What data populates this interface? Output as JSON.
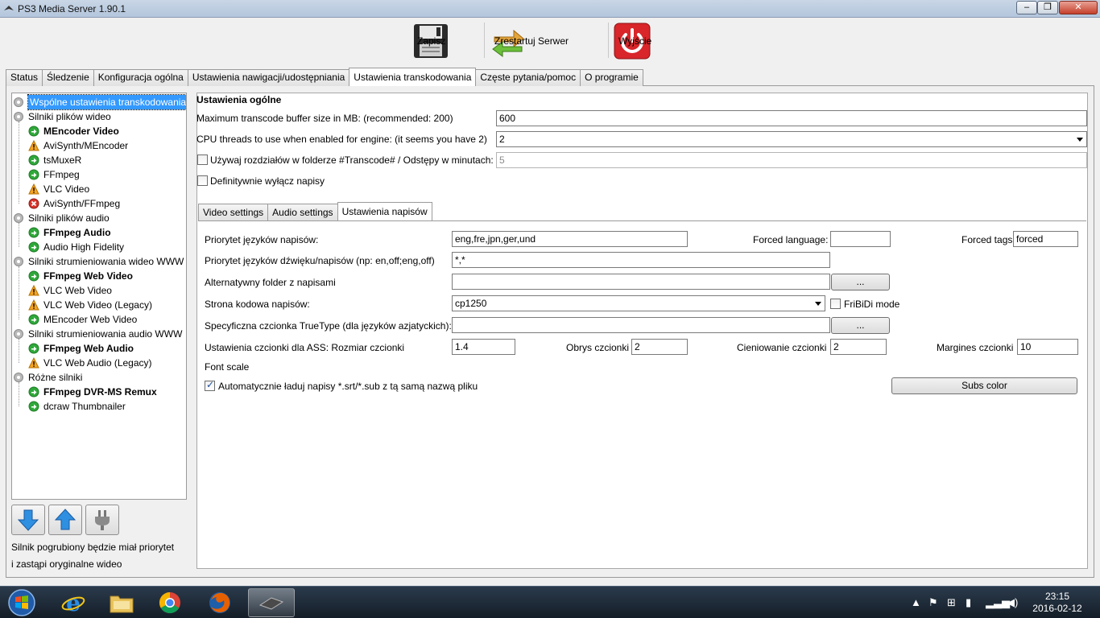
{
  "window": {
    "title": "PS3 Media Server 1.90.1",
    "minimize": "–",
    "maximize": "❐",
    "close": "✕"
  },
  "toolbar": {
    "save": "Zapisz",
    "restart": "Zrestartuj Serwer",
    "exit": "Wyjście"
  },
  "main_tabs": [
    "Status",
    "Śledzenie",
    "Konfiguracja ogólna",
    "Ustawienia nawigacji/udostępniania",
    "Ustawienia transkodowania",
    "Częste pytania/pomoc",
    "O programie"
  ],
  "tree": [
    {
      "label": "Wspólne ustawienia transkodowania",
      "level": 0,
      "icon": "gear-icon",
      "bold": false,
      "selected": true
    },
    {
      "label": "Silniki plików wideo",
      "level": 0,
      "icon": "gear-icon",
      "bold": false
    },
    {
      "label": "MEncoder Video",
      "level": 1,
      "icon": "ok-icon",
      "bold": true
    },
    {
      "label": "AviSynth/MEncoder",
      "level": 1,
      "icon": "warning-icon",
      "bold": false
    },
    {
      "label": "tsMuxeR",
      "level": 1,
      "icon": "ok-icon",
      "bold": false
    },
    {
      "label": "FFmpeg",
      "level": 1,
      "icon": "ok-icon",
      "bold": false
    },
    {
      "label": "VLC Video",
      "level": 1,
      "icon": "warning-icon",
      "bold": false
    },
    {
      "label": "AviSynth/FFmpeg",
      "level": 1,
      "icon": "error-icon",
      "bold": false
    },
    {
      "label": "Silniki plików audio",
      "level": 0,
      "icon": "gear-icon",
      "bold": false
    },
    {
      "label": "FFmpeg Audio",
      "level": 1,
      "icon": "ok-icon",
      "bold": true
    },
    {
      "label": "Audio High Fidelity",
      "level": 1,
      "icon": "ok-icon",
      "bold": false
    },
    {
      "label": "Silniki strumieniowania wideo WWW",
      "level": 0,
      "icon": "gear-icon",
      "bold": false
    },
    {
      "label": "FFmpeg Web Video",
      "level": 1,
      "icon": "ok-icon",
      "bold": true
    },
    {
      "label": "VLC Web Video",
      "level": 1,
      "icon": "warning-icon",
      "bold": false
    },
    {
      "label": "VLC Web Video (Legacy)",
      "level": 1,
      "icon": "warning-icon",
      "bold": false
    },
    {
      "label": "MEncoder Web Video",
      "level": 1,
      "icon": "ok-icon",
      "bold": false
    },
    {
      "label": "Silniki strumieniowania audio WWW",
      "level": 0,
      "icon": "gear-icon",
      "bold": false
    },
    {
      "label": "FFmpeg Web Audio",
      "level": 1,
      "icon": "ok-icon",
      "bold": true
    },
    {
      "label": "VLC Web Audio (Legacy)",
      "level": 1,
      "icon": "warning-icon",
      "bold": false
    },
    {
      "label": "Różne silniki",
      "level": 0,
      "icon": "gear-icon",
      "bold": false
    },
    {
      "label": "FFmpeg DVR-MS Remux",
      "level": 1,
      "icon": "ok-icon",
      "bold": true
    },
    {
      "label": "dcraw Thumbnailer",
      "level": 1,
      "icon": "ok-icon",
      "bold": false
    }
  ],
  "hint": {
    "line1": "Silnik pogrubiony będzie miał priorytet",
    "line2": "i zastąpi oryginalne wideo"
  },
  "general": {
    "title": "Ustawienia ogólne",
    "buffer_label": "Maximum transcode buffer size in MB: (recommended: 200)",
    "buffer_value": "600",
    "threads_label": "CPU threads to use when enabled for engine: (it seems you have 2)",
    "threads_value": "2",
    "chapters_label": "Używaj rozdziałów w folderze #Transcode# / Odstępy w minutach:",
    "chapters_value": "5",
    "disable_subs_label": "Definitywnie wyłącz napisy"
  },
  "sub_tabs": [
    "Video settings",
    "Audio settings",
    "Ustawienia napisów"
  ],
  "subs": {
    "lang_priority_label": "Priorytet języków napisów:",
    "lang_priority_value": "eng,fre,jpn,ger,und",
    "forced_language_label": "Forced language:",
    "forced_language_value": "",
    "forced_tags_label": "Forced tags:",
    "forced_tags_value": "forced",
    "audio_sub_priority_label": "Priorytet języków dźwięku/napisów (np: en,off;eng,off)",
    "audio_sub_priority_value": "*,*",
    "alt_folder_label": "Alternatywny folder z napisami",
    "alt_folder_value": "",
    "browse_label": "...",
    "codepage_label": "Strona kodowa napisów:",
    "codepage_value": "cp1250",
    "fribidi_label": "FriBiDi mode",
    "truetype_label": "Specyficzna czcionka TrueType (dla języków azjatyckich):",
    "truetype_value": "",
    "ass_label": "Ustawienia czcionki dla ASS: Rozmiar czcionki",
    "ass_size_value": "1.4",
    "outline_label": "Obrys czcionki",
    "outline_value": "2",
    "shadow_label": "Cieniowanie czcionki",
    "shadow_value": "2",
    "margin_label": "Margines czcionki",
    "margin_value": "10",
    "font_scale_label": "Font scale",
    "autoload_label": "Automatycznie ładuj napisy *.srt/*.sub z tą samą nazwą pliku",
    "subs_color_label": "Subs color"
  },
  "taskbar": {
    "time": "23:15",
    "date": "2016-02-12"
  }
}
